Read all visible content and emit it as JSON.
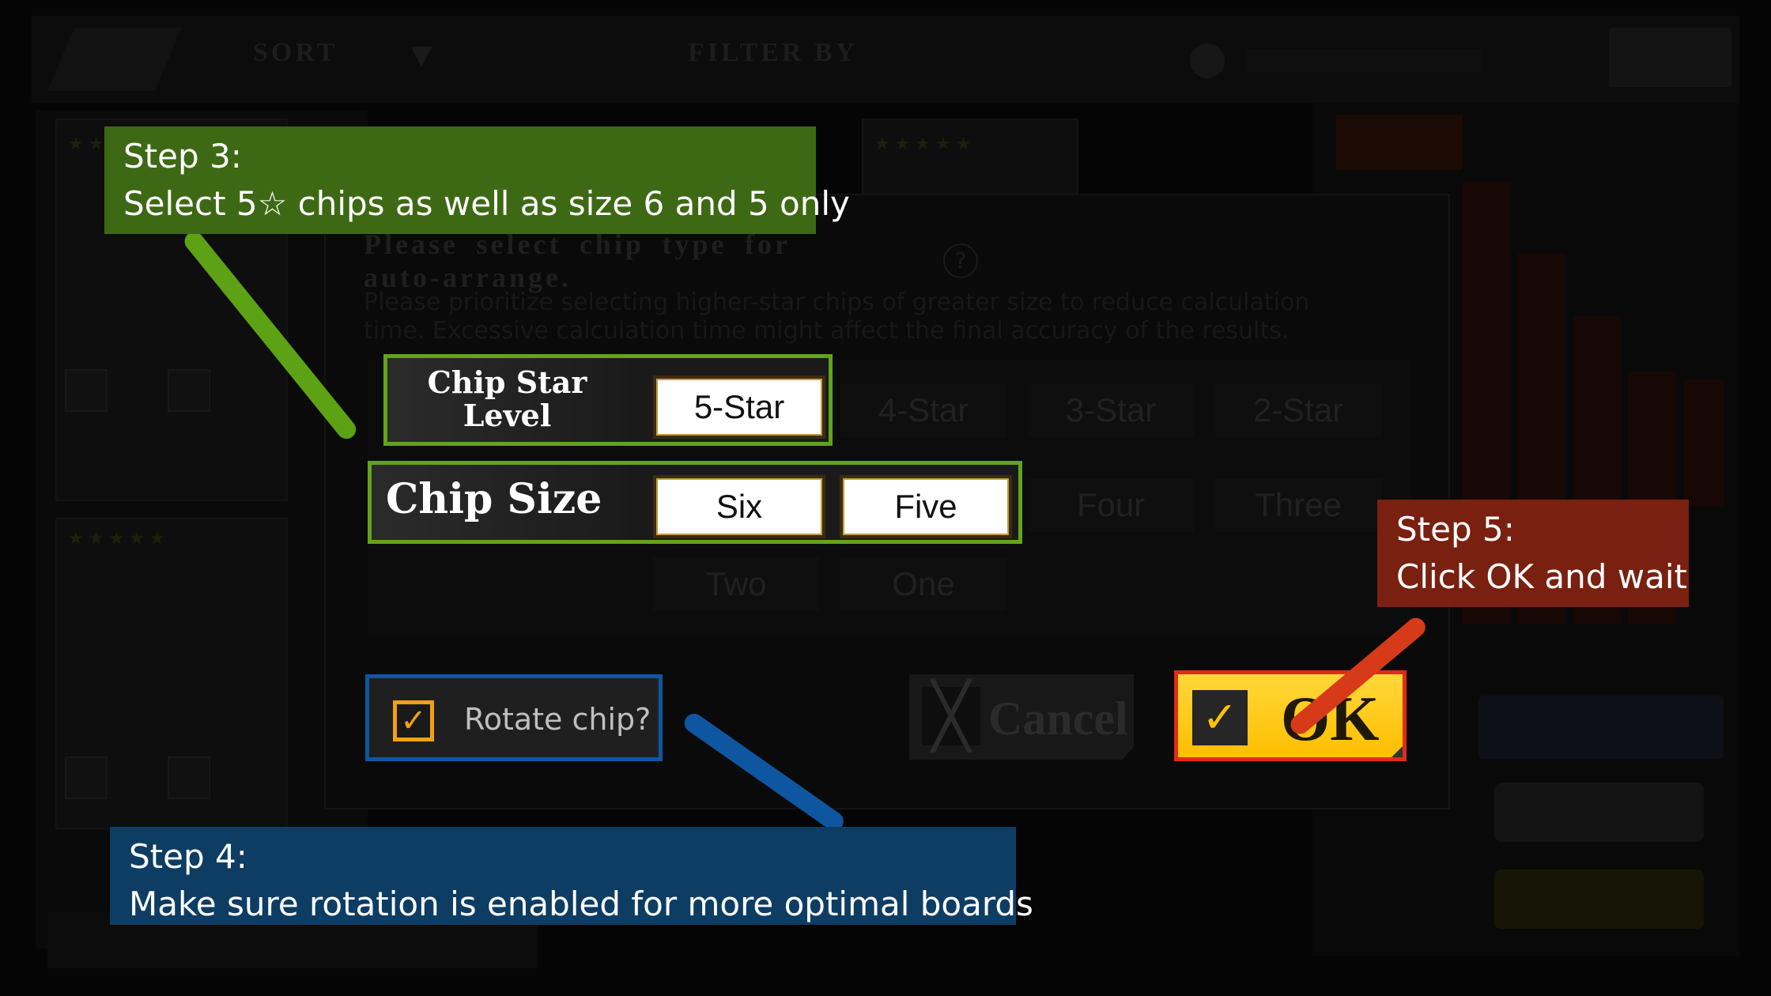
{
  "dialog": {
    "title": "Please select chip type for auto-arrange.",
    "help_icon": "question-icon",
    "note": "Please prioritize selecting higher-star chips of greater size to reduce calculation time. Excessive calculation time might affect the final accuracy of the results."
  },
  "star_level": {
    "label_line1": "Chip Star",
    "label_line2": "Level",
    "options": [
      "5-Star",
      "4-Star",
      "3-Star",
      "2-Star"
    ],
    "selected": [
      "5-Star"
    ]
  },
  "chip_size": {
    "label": "Chip Size",
    "options": [
      "Six",
      "Five",
      "Four",
      "Three",
      "Two",
      "One"
    ],
    "selected": [
      "Six",
      "Five"
    ]
  },
  "rotate": {
    "label": "Rotate chip?",
    "checked": true
  },
  "buttons": {
    "cancel": "Cancel",
    "ok": "OK"
  },
  "callouts": {
    "step3_title": "Step 3:",
    "step3_body": "Select 5☆ chips as well as size 6 and 5 only",
    "step4_title": "Step 4:",
    "step4_body": "Make sure rotation is enabled for more optimal boards",
    "step5_title": "Step 5:",
    "step5_body": "Click OK and wait"
  },
  "background": {
    "sort_label": "SORT",
    "filter_label": "FILTER BY"
  },
  "colors": {
    "step3": "#3e6914",
    "step4": "#0e3d64",
    "step5": "#792011",
    "highlight_green": "#63a31b",
    "highlight_blue": "#0f56a0",
    "highlight_red": "#e02d14",
    "ok_yellow": "#ffc400",
    "checkbox_orange": "#f2a014"
  }
}
